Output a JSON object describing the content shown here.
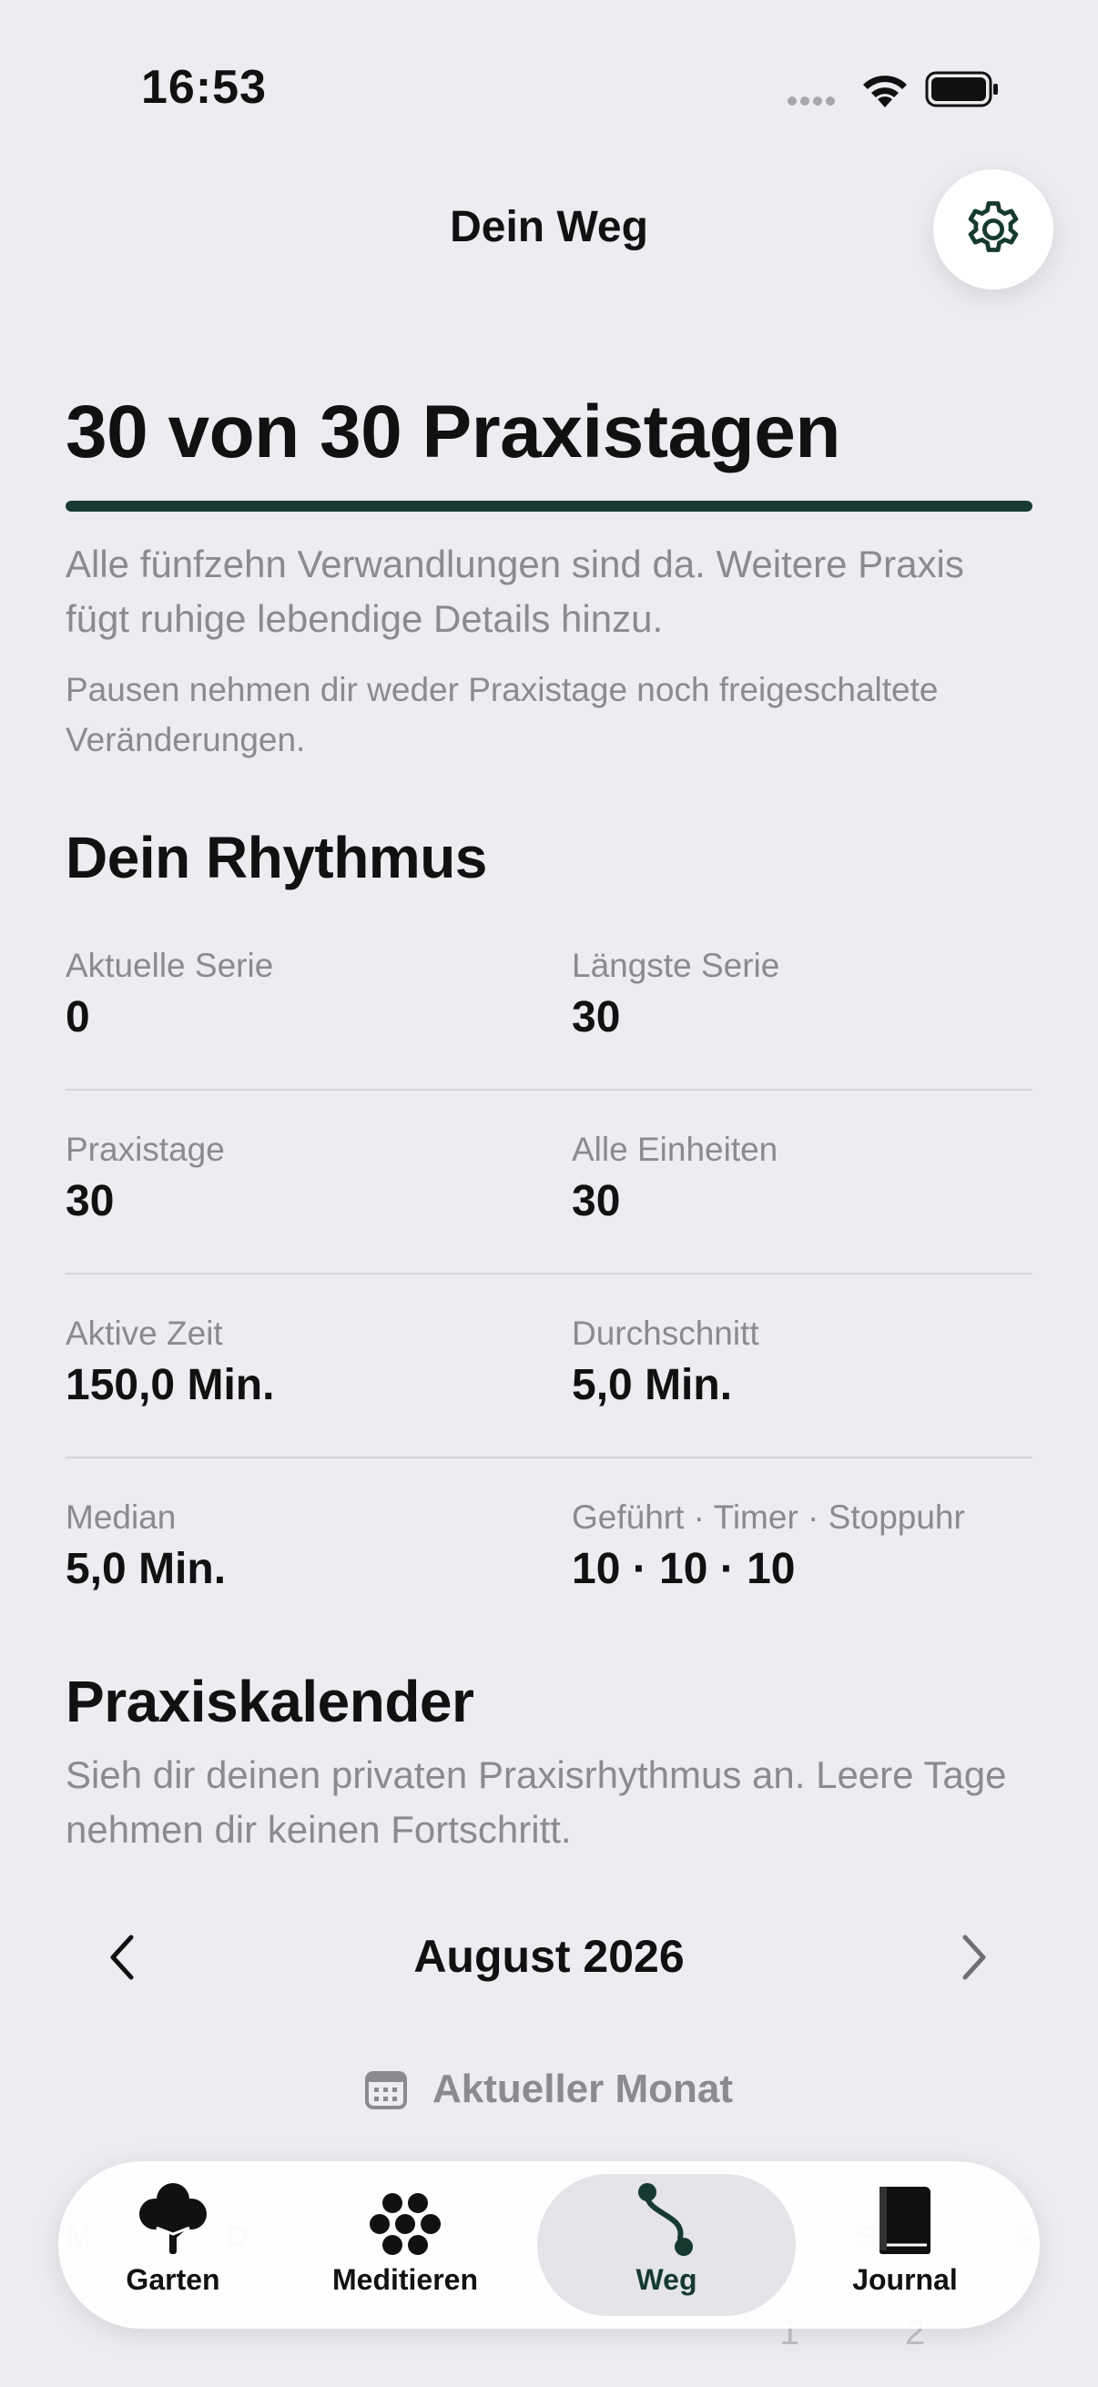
{
  "status_bar": {
    "time": "16:53"
  },
  "header": {
    "title": "Dein Weg"
  },
  "hero": {
    "title": "30 von 30 Praxistagen",
    "progress_fraction": 1.0,
    "description": "Alle fünfzehn Verwandlungen sind da. Weitere Praxis fügt ruhige lebendige Details hinzu.",
    "note": "Pausen nehmen dir weder Praxistage noch freigeschaltete Veränderungen."
  },
  "rhythm": {
    "title": "Dein Rhythmus",
    "stats": [
      {
        "label": "Aktuelle Serie",
        "value": "0"
      },
      {
        "label": "Längste Serie",
        "value": "30"
      },
      {
        "label": "Praxistage",
        "value": "30"
      },
      {
        "label": "Alle Einheiten",
        "value": "30"
      },
      {
        "label": "Aktive Zeit",
        "value": "150,0 Min."
      },
      {
        "label": "Durchschnitt",
        "value": "5,0 Min."
      },
      {
        "label": "Median",
        "value": "5,0 Min."
      },
      {
        "label": "Geführt · Timer · Stoppuhr",
        "value": "10 · 10 · 10"
      }
    ]
  },
  "calendar": {
    "title": "Praxiskalender",
    "description": "Sieh dir deinen privaten Praxisrhythmus an. Leere Tage nehmen dir keinen Fortschritt.",
    "month": "August 2026",
    "current_month_label": "Aktueller Monat",
    "weekdays": [
      "M",
      "D",
      "M",
      "D",
      "F",
      "S",
      "S"
    ],
    "visible_days": [
      "1",
      "2"
    ]
  },
  "tabbar": {
    "tabs": [
      {
        "label": "Garten",
        "icon": "tree-icon"
      },
      {
        "label": "Meditieren",
        "icon": "flower-dots-icon"
      },
      {
        "label": "Weg",
        "icon": "path-icon",
        "selected": true
      },
      {
        "label": "Journal",
        "icon": "book-icon"
      }
    ]
  },
  "colors": {
    "accent": "#163a30",
    "background": "#ececf1",
    "secondary_text": "#8a8a8f"
  }
}
